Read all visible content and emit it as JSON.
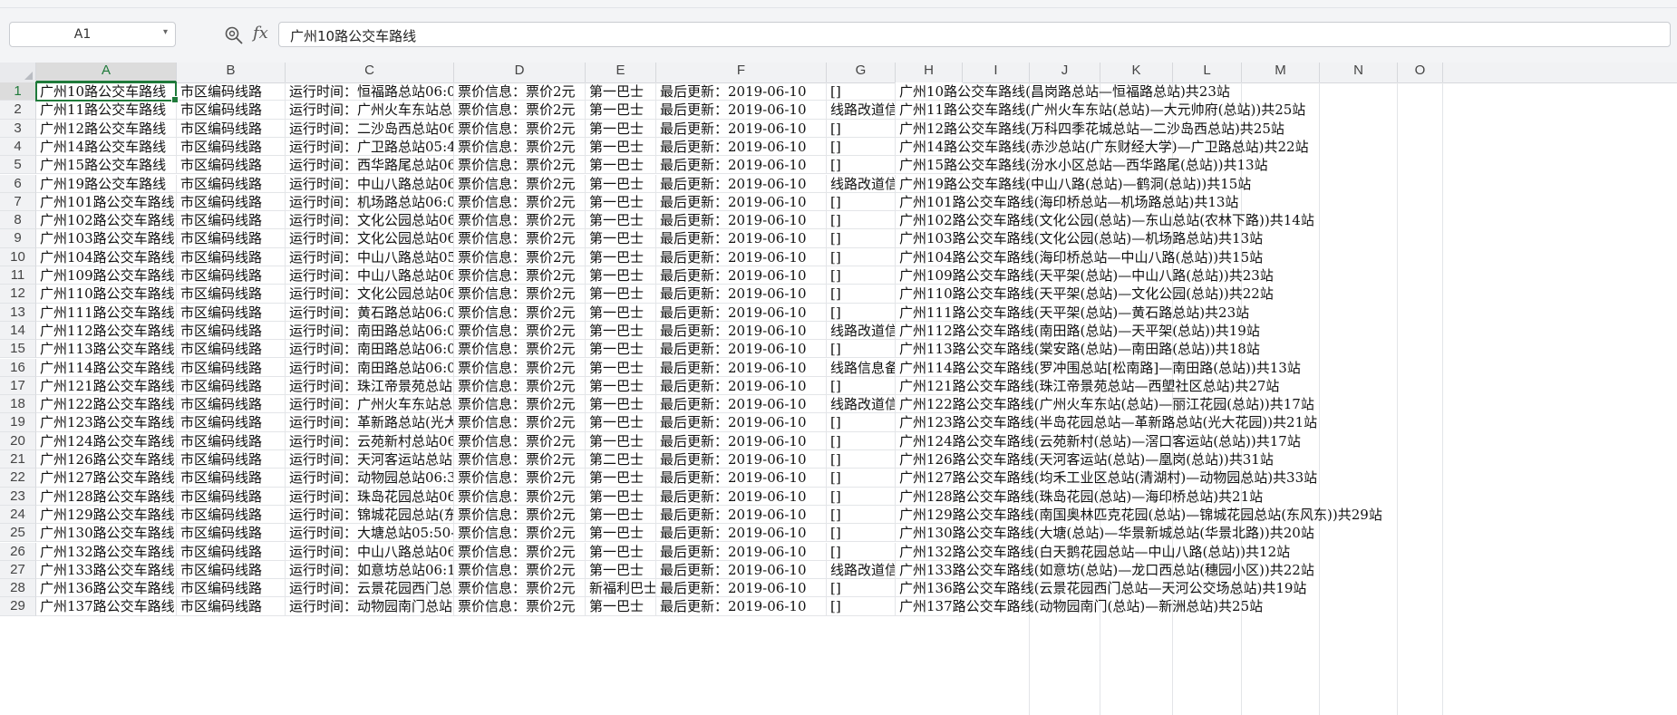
{
  "name_box": {
    "value": "A1"
  },
  "formula_bar": {
    "fx_label": "fx",
    "value": "广州10路公交车路线"
  },
  "columns": [
    "A",
    "B",
    "C",
    "D",
    "E",
    "F",
    "G",
    "H",
    "I",
    "J",
    "K",
    "L",
    "M",
    "N",
    "O"
  ],
  "selected": {
    "row": 1,
    "col": "A"
  },
  "rows": [
    {
      "n": 1,
      "A": "广州10路公交车路线",
      "B": "市区编码线路",
      "C": "运行时间：恒福路总站06:0",
      "D": "票价信息：票价2元",
      "E": "第一巴士",
      "F": "最后更新：2019-06-10",
      "G": "[]",
      "H": "广州10路公交车路线(昌岗路总站—恒福路总站)共23站"
    },
    {
      "n": 2,
      "A": "广州11路公交车路线",
      "B": "市区编码线路",
      "C": "运行时间：广州火车东站总",
      "D": "票价信息：票价2元",
      "E": "第一巴士",
      "F": "最后更新：2019-06-10",
      "G": "线路改道信",
      "H": "广州11路公交车路线(广州火车东站(总站)—大元帅府(总站))共25站"
    },
    {
      "n": 3,
      "A": "广州12路公交车路线",
      "B": "市区编码线路",
      "C": "运行时间：二沙岛西总站06",
      "D": "票价信息：票价2元",
      "E": "第一巴士",
      "F": "最后更新：2019-06-10",
      "G": "[]",
      "H": "广州12路公交车路线(万科四季花城总站—二沙岛西总站)共25站"
    },
    {
      "n": 4,
      "A": "广州14路公交车路线",
      "B": "市区编码线路",
      "C": "运行时间：广卫路总站05:4",
      "D": "票价信息：票价2元",
      "E": "第一巴士",
      "F": "最后更新：2019-06-10",
      "G": "[]",
      "H": "广州14路公交车路线(赤沙总站(广东财经大学)—广卫路总站)共22站"
    },
    {
      "n": 5,
      "A": "广州15路公交车路线",
      "B": "市区编码线路",
      "C": "运行时间：西华路尾总站06",
      "D": "票价信息：票价2元",
      "E": "第一巴士",
      "F": "最后更新：2019-06-10",
      "G": "[]",
      "H": "广州15路公交车路线(汾水小区总站—西华路尾(总站))共13站"
    },
    {
      "n": 6,
      "A": "广州19路公交车路线",
      "B": "市区编码线路",
      "C": "运行时间：中山八路总站06",
      "D": "票价信息：票价2元",
      "E": "第一巴士",
      "F": "最后更新：2019-06-10",
      "G": "线路改道信",
      "H": "广州19路公交车路线(中山八路(总站)—鹤洞(总站))共15站"
    },
    {
      "n": 7,
      "A": "广州101路公交车路线",
      "B": "市区编码线路",
      "C": "运行时间：机场路总站06:0",
      "D": "票价信息：票价2元",
      "E": "第一巴士",
      "F": "最后更新：2019-06-10",
      "G": "[]",
      "H": "广州101路公交车路线(海印桥总站—机场路总站)共13站"
    },
    {
      "n": 8,
      "A": "广州102路公交车路线",
      "B": "市区编码线路",
      "C": "运行时间：文化公园总站06",
      "D": "票价信息：票价2元",
      "E": "第一巴士",
      "F": "最后更新：2019-06-10",
      "G": "[]",
      "H": "广州102路公交车路线(文化公园(总站)—东山总站(农林下路))共14站"
    },
    {
      "n": 9,
      "A": "广州103路公交车路线",
      "B": "市区编码线路",
      "C": "运行时间：文化公园总站06",
      "D": "票价信息：票价2元",
      "E": "第一巴士",
      "F": "最后更新：2019-06-10",
      "G": "[]",
      "H": "广州103路公交车路线(文化公园(总站)—机场路总站)共13站"
    },
    {
      "n": 10,
      "A": "广州104路公交车路线",
      "B": "市区编码线路",
      "C": "运行时间：中山八路总站05",
      "D": "票价信息：票价2元",
      "E": "第一巴士",
      "F": "最后更新：2019-06-10",
      "G": "[]",
      "H": "广州104路公交车路线(海印桥总站—中山八路(总站))共15站"
    },
    {
      "n": 11,
      "A": "广州109路公交车路线",
      "B": "市区编码线路",
      "C": "运行时间：中山八路总站06",
      "D": "票价信息：票价2元",
      "E": "第一巴士",
      "F": "最后更新：2019-06-10",
      "G": "[]",
      "H": "广州109路公交车路线(天平架(总站)—中山八路(总站))共23站"
    },
    {
      "n": 12,
      "A": "广州110路公交车路线",
      "B": "市区编码线路",
      "C": "运行时间：文化公园总站06",
      "D": "票价信息：票价2元",
      "E": "第一巴士",
      "F": "最后更新：2019-06-10",
      "G": "[]",
      "H": "广州110路公交车路线(天平架(总站)—文化公园(总站))共22站"
    },
    {
      "n": 13,
      "A": "广州111路公交车路线",
      "B": "市区编码线路",
      "C": "运行时间：黄石路总站06:0",
      "D": "票价信息：票价2元",
      "E": "第一巴士",
      "F": "最后更新：2019-06-10",
      "G": "[]",
      "H": "广州111路公交车路线(天平架(总站)—黄石路总站)共23站"
    },
    {
      "n": 14,
      "A": "广州112路公交车路线",
      "B": "市区编码线路",
      "C": "运行时间：南田路总站06:0",
      "D": "票价信息：票价2元",
      "E": "第一巴士",
      "F": "最后更新：2019-06-10",
      "G": "线路改道信",
      "H": "广州112路公交车路线(南田路(总站)—天平架(总站))共19站"
    },
    {
      "n": 15,
      "A": "广州113路公交车路线",
      "B": "市区编码线路",
      "C": "运行时间：南田路总站06:0",
      "D": "票价信息：票价2元",
      "E": "第一巴士",
      "F": "最后更新：2019-06-10",
      "G": "[]",
      "H": "广州113路公交车路线(棠安路(总站)—南田路(总站))共18站"
    },
    {
      "n": 16,
      "A": "广州114路公交车路线",
      "B": "市区编码线路",
      "C": "运行时间：南田路总站06:0",
      "D": "票价信息：票价2元",
      "E": "第一巴士",
      "F": "最后更新：2019-06-10",
      "G": "线路信息备",
      "H": "广州114路公交车路线(罗冲围总站[松南路]—南田路(总站))共13站"
    },
    {
      "n": 17,
      "A": "广州121路公交车路线",
      "B": "市区编码线路",
      "C": "运行时间：珠江帝景苑总站",
      "D": "票价信息：票价2元",
      "E": "第一巴士",
      "F": "最后更新：2019-06-10",
      "G": "[]",
      "H": "广州121路公交车路线(珠江帝景苑总站—西塱社区总站)共27站"
    },
    {
      "n": 18,
      "A": "广州122路公交车路线",
      "B": "市区编码线路",
      "C": "运行时间：广州火车东站总",
      "D": "票价信息：票价2元",
      "E": "第一巴士",
      "F": "最后更新：2019-06-10",
      "G": "线路改道信",
      "H": "广州122路公交车路线(广州火车东站(总站)—丽江花园(总站))共17站"
    },
    {
      "n": 19,
      "A": "广州123路公交车路线",
      "B": "市区编码线路",
      "C": "运行时间：革新路总站(光大",
      "D": "票价信息：票价2元",
      "E": "第一巴士",
      "F": "最后更新：2019-06-10",
      "G": "[]",
      "H": "广州123路公交车路线(半岛花园总站—革新路总站(光大花园))共21站"
    },
    {
      "n": 20,
      "A": "广州124路公交车路线",
      "B": "市区编码线路",
      "C": "运行时间：云苑新村总站06",
      "D": "票价信息：票价2元",
      "E": "第一巴士",
      "F": "最后更新：2019-06-10",
      "G": "[]",
      "H": "广州124路公交车路线(云苑新村(总站)—滘口客运站(总站))共17站"
    },
    {
      "n": 21,
      "A": "广州126路公交车路线",
      "B": "市区编码线路",
      "C": "运行时间：天河客运站总站",
      "D": "票价信息：票价2元",
      "E": "第二巴士",
      "F": "最后更新：2019-06-10",
      "G": "[]",
      "H": "广州126路公交车路线(天河客运站(总站)—凰岗(总站))共31站"
    },
    {
      "n": 22,
      "A": "广州127路公交车路线",
      "B": "市区编码线路",
      "C": "运行时间：动物园总站06:3",
      "D": "票价信息：票价2元",
      "E": "第一巴士",
      "F": "最后更新：2019-06-10",
      "G": "[]",
      "H": "广州127路公交车路线(均禾工业区总站(清湖村)—动物园总站)共33站"
    },
    {
      "n": 23,
      "A": "广州128路公交车路线",
      "B": "市区编码线路",
      "C": "运行时间：珠岛花园总站06",
      "D": "票价信息：票价2元",
      "E": "第一巴士",
      "F": "最后更新：2019-06-10",
      "G": "[]",
      "H": "广州128路公交车路线(珠岛花园(总站)—海印桥总站)共21站"
    },
    {
      "n": 24,
      "A": "广州129路公交车路线",
      "B": "市区编码线路",
      "C": "运行时间：锦城花园总站(东",
      "D": "票价信息：票价2元",
      "E": "第一巴士",
      "F": "最后更新：2019-06-10",
      "G": "[]",
      "H": "广州129路公交车路线(南国奥林匹克花园(总站)—锦城花园总站(东风东))共29站"
    },
    {
      "n": 25,
      "A": "广州130路公交车路线",
      "B": "市区编码线路",
      "C": "运行时间：大塘总站05:50-",
      "D": "票价信息：票价2元",
      "E": "第一巴士",
      "F": "最后更新：2019-06-10",
      "G": "[]",
      "H": "广州130路公交车路线(大塘(总站)—华景新城总站(华景北路))共20站"
    },
    {
      "n": 26,
      "A": "广州132路公交车路线",
      "B": "市区编码线路",
      "C": "运行时间：中山八路总站06",
      "D": "票价信息：票价2元",
      "E": "第一巴士",
      "F": "最后更新：2019-06-10",
      "G": "[]",
      "H": "广州132路公交车路线(白天鹅花园总站—中山八路(总站))共12站"
    },
    {
      "n": 27,
      "A": "广州133路公交车路线",
      "B": "市区编码线路",
      "C": "运行时间：如意坊总站06:1",
      "D": "票价信息：票价2元",
      "E": "第一巴士",
      "F": "最后更新：2019-06-10",
      "G": "线路改道信",
      "H": "广州133路公交车路线(如意坊(总站)—龙口西总站(穗园小区))共22站"
    },
    {
      "n": 28,
      "A": "广州136路公交车路线",
      "B": "市区编码线路",
      "C": "运行时间：云景花园西门总",
      "D": "票价信息：票价2元",
      "E": "新福利巴士",
      "F": "最后更新：2019-06-10",
      "G": "[]",
      "H": "广州136路公交车路线(云景花园西门总站—天河公交场总站)共19站"
    },
    {
      "n": 29,
      "A": "广州137路公交车路线",
      "B": "市区编码线路",
      "C": "运行时间：动物园南门总站",
      "D": "票价信息：票价2元",
      "E": "第一巴士",
      "F": "最后更新：2019-06-10",
      "G": "[]",
      "H": "广州137路公交车路线(动物园南门(总站)—新洲总站)共25站"
    }
  ]
}
